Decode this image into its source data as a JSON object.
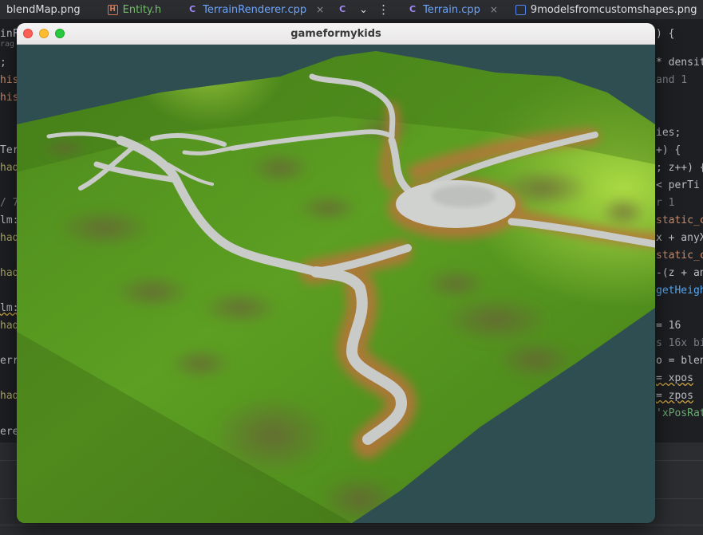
{
  "tabs": [
    {
      "label": "blendMap.png",
      "icon": "image-icon",
      "style": "plain",
      "closable": false
    },
    {
      "label": "Entity.h",
      "icon": "header-file-icon",
      "style": "modified",
      "closable": false
    },
    {
      "label": "TerrainRenderer.cpp",
      "icon": "cpp-file-icon",
      "style": "blue",
      "closable": true
    },
    {
      "label": "",
      "icon": "cpp-file-icon",
      "style": "plain",
      "closable": false
    },
    {
      "label": "Terrain.cpp",
      "icon": "cpp-file-icon",
      "style": "blue",
      "closable": true
    },
    {
      "label": "9modelsfromcustomshapes.png",
      "icon": "image-icon",
      "style": "plain",
      "closable": false
    }
  ],
  "tab_close_glyph": "×",
  "tab_overflow_glyph": "⌄",
  "tab_menu_glyph": "⋮",
  "code_left": {
    "line_top": "inF",
    "line_hint": "rag",
    "semicolon": ";",
    "his1": "his",
    "his2": "his",
    "ter": "Ter",
    "had1": "had",
    "comment": "/ 7",
    "lm1": "lm:",
    "had2": "had",
    "had3": "had",
    "lm2": "lm:",
    "had4": "had",
    "err": "err",
    "had5": "had",
    "status": "erer"
  },
  "code_right": {
    "l1": ") {",
    "l2": "* densit",
    "l3": "and 1",
    "l4": "ies;",
    "l5": "+) {",
    "l6": "; z++) {",
    "l7": "< perTi",
    "l8": "r 1",
    "l9": "static_c",
    "l10": "x + anyX",
    "l11": "static_c",
    "l12": "-(z + an",
    "l13": "getHeigh",
    "l14": "= 16",
    "l15": "s 16x bi",
    "l16": "o = blen",
    "l17": "= xpos",
    "l18": "= zpos",
    "l19": "'xPosRat"
  },
  "window": {
    "title": "gameformykids",
    "scene": "3d-terrain-view"
  },
  "colors": {
    "ide_bg": "#1e1f22",
    "window_bg": "#2f4e51",
    "grass": "#5a9a22",
    "path": "#c7c9c6",
    "dirt": "#b8743a"
  }
}
